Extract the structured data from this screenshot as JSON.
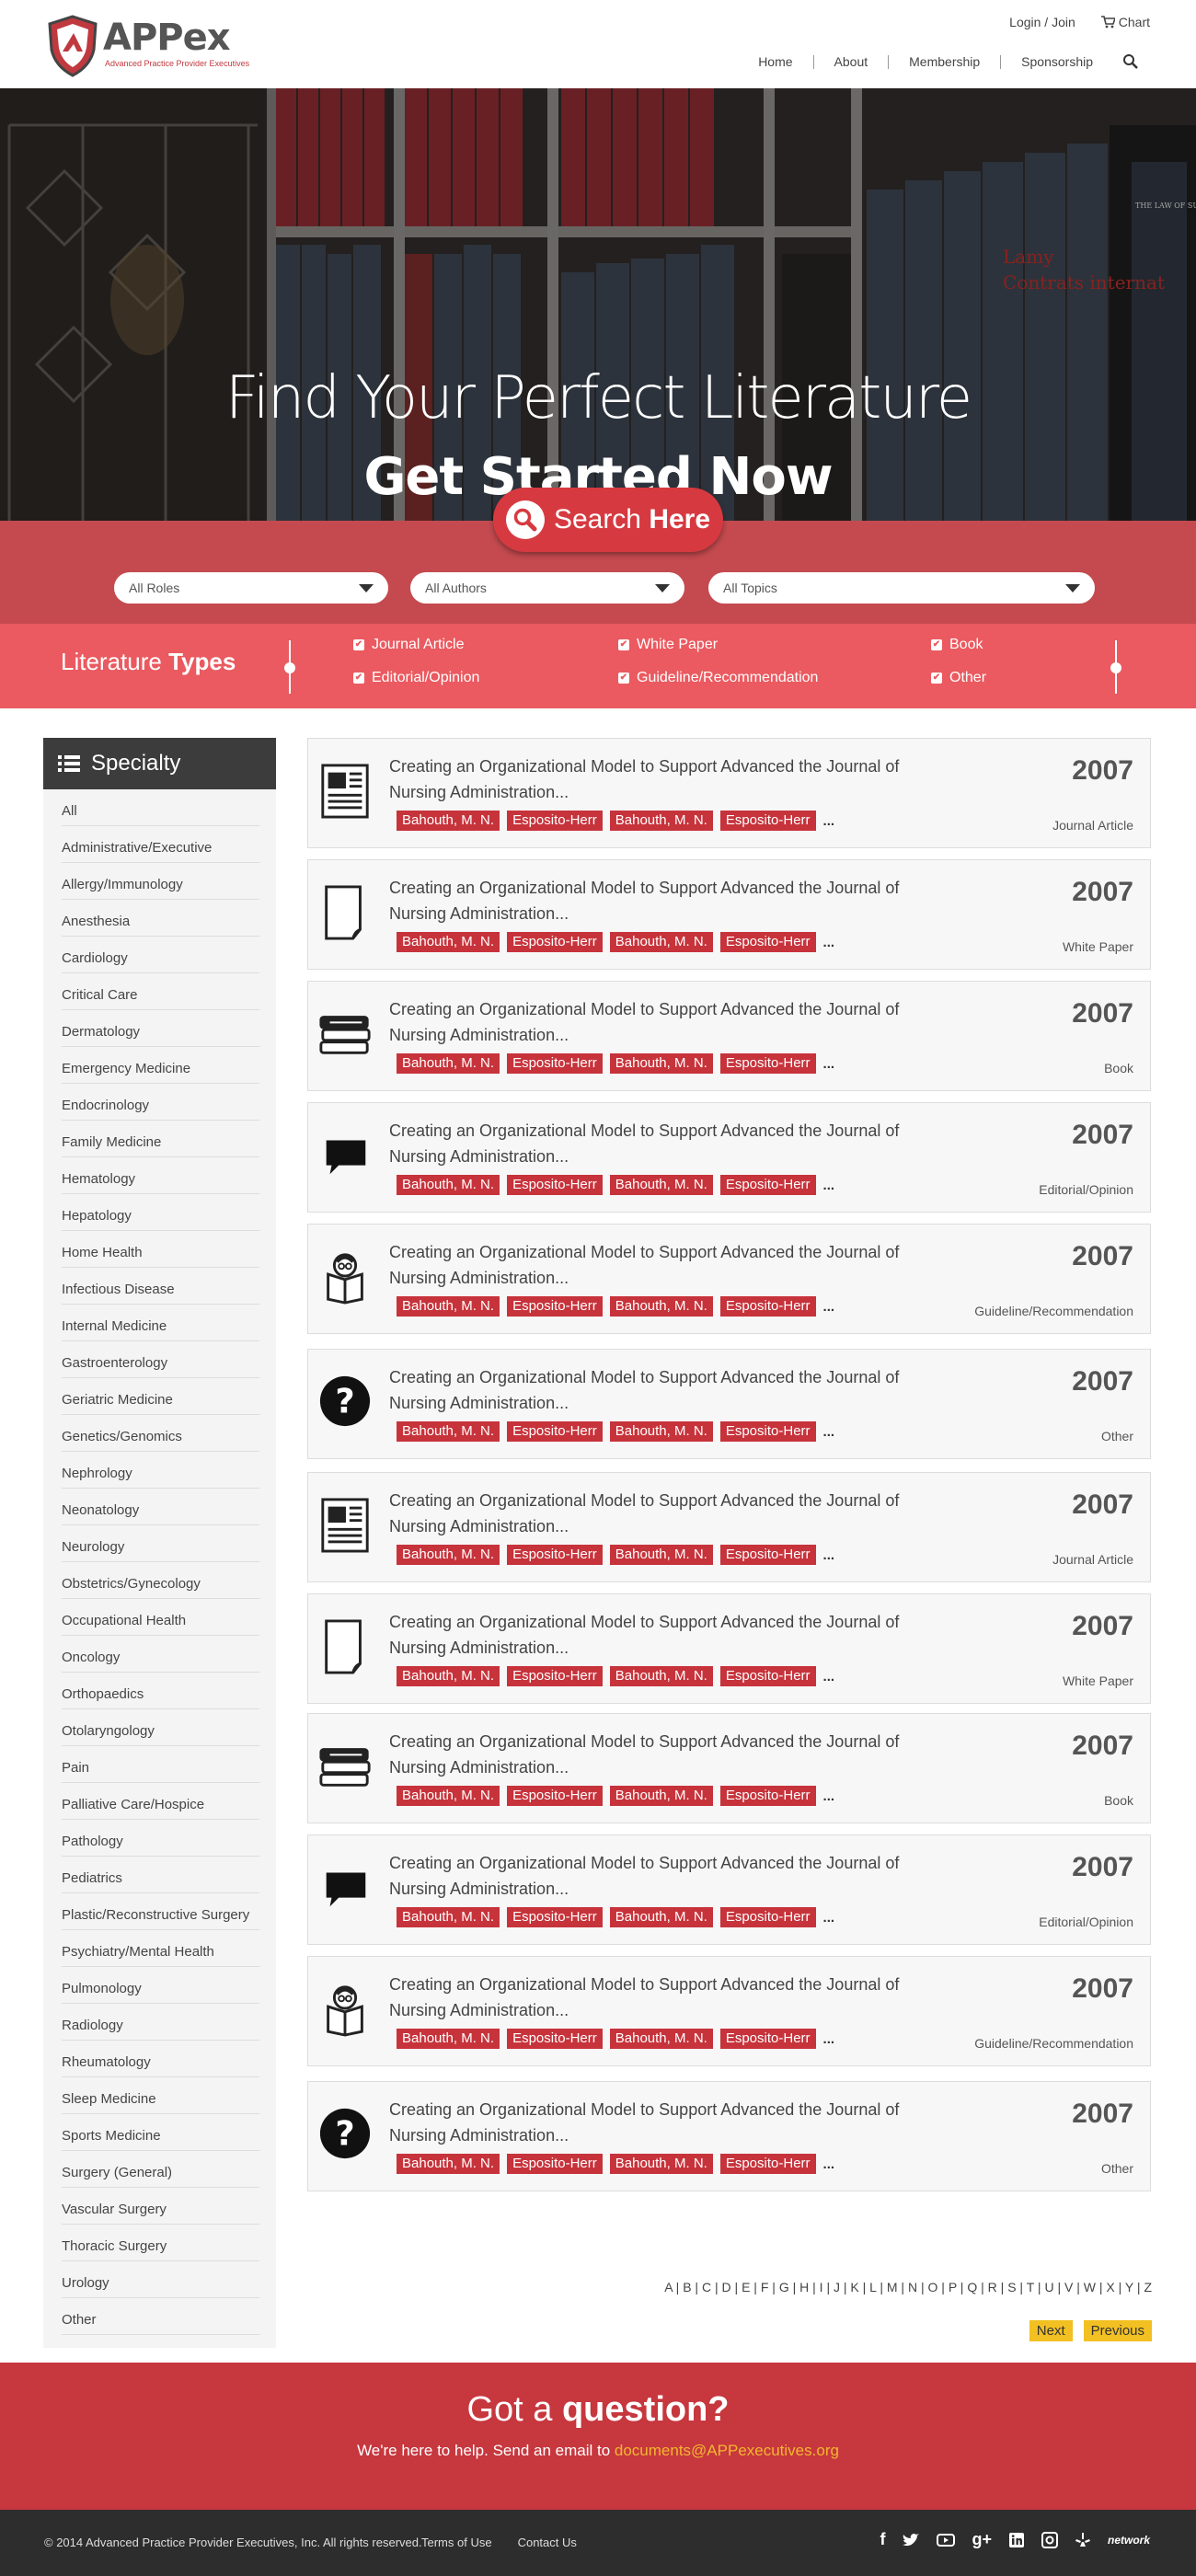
{
  "header": {
    "logo_text": "APPex",
    "logo_sub": "Advanced Practice Provider Executives",
    "login_label": "Login / Join",
    "cart_label": "Chart",
    "nav": [
      "Home",
      "About",
      "Membership",
      "Sponsorship"
    ]
  },
  "hero": {
    "title": "Find Your Perfect Literature",
    "subtitle": "Get Started Now",
    "book_text_1": "Lamy",
    "book_text_2": "Contrats internat",
    "book_text_3": "THE LAW OF SUBROGATION"
  },
  "search": {
    "label_light": "Search ",
    "label_bold": "Here",
    "roles_placeholder": "All Roles",
    "authors_placeholder": "All Authors",
    "topics_placeholder": "All Topics"
  },
  "literature_types": {
    "label_light": "Literature ",
    "label_bold": "Types",
    "options": [
      "Journal Article",
      "White Paper",
      "Book",
      "Editorial/Opinion",
      "Guideline/Recommendation",
      "Other"
    ]
  },
  "sidebar": {
    "title": "Specialty",
    "items": [
      "All",
      "Administrative/Executive",
      "Allergy/Immunology",
      "Anesthesia",
      "Cardiology",
      "Critical Care",
      "Dermatology",
      "Emergency Medicine",
      "Endocrinology",
      "Family Medicine",
      "Hematology",
      "Hepatology",
      "Home Health",
      "Infectious Disease",
      "Internal Medicine",
      "Gastroenterology",
      "Geriatric Medicine",
      "Genetics/Genomics",
      "Nephrology",
      "Neonatology",
      "Neurology",
      "Obstetrics/Gynecology",
      "Occupational Health",
      "Oncology",
      "Orthopaedics",
      "Otolaryngology",
      "Pain",
      "Palliative Care/Hospice",
      "Pathology",
      "Pediatrics",
      "Plastic/Reconstructive Surgery",
      "Psychiatry/Mental Health",
      "Pulmonology",
      "Radiology",
      "Rheumatology",
      "Sleep Medicine",
      "Sports Medicine",
      "Surgery (General)",
      "Vascular Surgery",
      "Thoracic Surgery",
      "Urology",
      "Other"
    ]
  },
  "results": [
    {
      "title": "Creating an Organizational Model to Support Advanced the Journal of Nursing Administration...",
      "authors": [
        "Bahouth, M. N.",
        "Esposito-Herr",
        "Bahouth, M. N.",
        "Esposito-Herr"
      ],
      "year": "2007",
      "type": "Journal Article",
      "icon": "journal-icon"
    },
    {
      "title": "Creating an Organizational Model to Support Advanced the Journal of Nursing Administration...",
      "authors": [
        "Bahouth, M. N.",
        "Esposito-Herr",
        "Bahouth, M. N.",
        "Esposito-Herr"
      ],
      "year": "2007",
      "type": "White Paper",
      "icon": "paper-icon"
    },
    {
      "title": "Creating an Organizational Model to Support Advanced the Journal of Nursing Administration...",
      "authors": [
        "Bahouth, M. N.",
        "Esposito-Herr",
        "Bahouth, M. N.",
        "Esposito-Herr"
      ],
      "year": "2007",
      "type": "Book",
      "icon": "books-icon"
    },
    {
      "title": "Creating an Organizational Model to Support Advanced the Journal of Nursing Administration...",
      "authors": [
        "Bahouth, M. N.",
        "Esposito-Herr",
        "Bahouth, M. N.",
        "Esposito-Herr"
      ],
      "year": "2007",
      "type": "Editorial/Opinion",
      "icon": "speech-bubble-icon"
    },
    {
      "title": "Creating an Organizational Model to Support Advanced the Journal of Nursing Administration...",
      "authors": [
        "Bahouth, M. N.",
        "Esposito-Herr",
        "Bahouth, M. N.",
        "Esposito-Herr"
      ],
      "year": "2007",
      "type": "Guideline/Recommendation",
      "icon": "reader-icon"
    },
    {
      "title": "Creating an Organizational Model to Support Advanced the Journal of Nursing Administration...",
      "authors": [
        "Bahouth, M. N.",
        "Esposito-Herr",
        "Bahouth, M. N.",
        "Esposito-Herr"
      ],
      "year": "2007",
      "type": "Other",
      "icon": "question-icon"
    },
    {
      "title": "Creating an Organizational Model to Support Advanced the Journal of Nursing Administration...",
      "authors": [
        "Bahouth, M. N.",
        "Esposito-Herr",
        "Bahouth, M. N.",
        "Esposito-Herr"
      ],
      "year": "2007",
      "type": "Journal Article",
      "icon": "journal-icon"
    },
    {
      "title": "Creating an Organizational Model to Support Advanced the Journal of Nursing Administration...",
      "authors": [
        "Bahouth, M. N.",
        "Esposito-Herr",
        "Bahouth, M. N.",
        "Esposito-Herr"
      ],
      "year": "2007",
      "type": "White Paper",
      "icon": "paper-icon"
    },
    {
      "title": "Creating an Organizational Model to Support Advanced the Journal of Nursing Administration...",
      "authors": [
        "Bahouth, M. N.",
        "Esposito-Herr",
        "Bahouth, M. N.",
        "Esposito-Herr"
      ],
      "year": "2007",
      "type": "Book",
      "icon": "books-icon"
    },
    {
      "title": "Creating an Organizational Model to Support Advanced the Journal of Nursing Administration...",
      "authors": [
        "Bahouth, M. N.",
        "Esposito-Herr",
        "Bahouth, M. N.",
        "Esposito-Herr"
      ],
      "year": "2007",
      "type": "Editorial/Opinion",
      "icon": "speech-bubble-icon"
    },
    {
      "title": "Creating an Organizational Model to Support Advanced the Journal of Nursing Administration...",
      "authors": [
        "Bahouth, M. N.",
        "Esposito-Herr",
        "Bahouth, M. N.",
        "Esposito-Herr"
      ],
      "year": "2007",
      "type": "Guideline/Recommendation",
      "icon": "reader-icon"
    },
    {
      "title": "Creating an Organizational Model to Support Advanced the Journal of Nursing Administration...",
      "authors": [
        "Bahouth, M. N.",
        "Esposito-Herr",
        "Bahouth, M. N.",
        "Esposito-Herr"
      ],
      "year": "2007",
      "type": "Other",
      "icon": "question-icon"
    }
  ],
  "alphabet": [
    "A",
    "B",
    "C",
    "D",
    "E",
    "F",
    "G",
    "H",
    "I",
    "J",
    "K",
    "L",
    "M",
    "N",
    "O",
    "P",
    "Q",
    "R",
    "S",
    "T",
    "U",
    "V",
    "W",
    "X",
    "Y",
    "Z"
  ],
  "pager": {
    "next": "Next",
    "previous": "Previous"
  },
  "question": {
    "title_light": "Got a ",
    "title_bold": "question?",
    "text": "We're here to help. Send an email to ",
    "email": "documents@APPexecutives.org"
  },
  "footer": {
    "copyright": "© 2014 Advanced Practice Provider Executives, Inc. All rights reserved.",
    "links": [
      "Terms of Use",
      "Contact Us"
    ],
    "social": [
      "facebook-icon",
      "twitter-icon",
      "youtube-icon",
      "google-plus-icon",
      "linkedin-icon",
      "instagram-icon",
      "yelp-icon"
    ],
    "network_label": "network"
  },
  "colors": {
    "brand_red": "#c7373e",
    "band_red": "#ea5a60",
    "accent_yellow": "#f2c022"
  }
}
